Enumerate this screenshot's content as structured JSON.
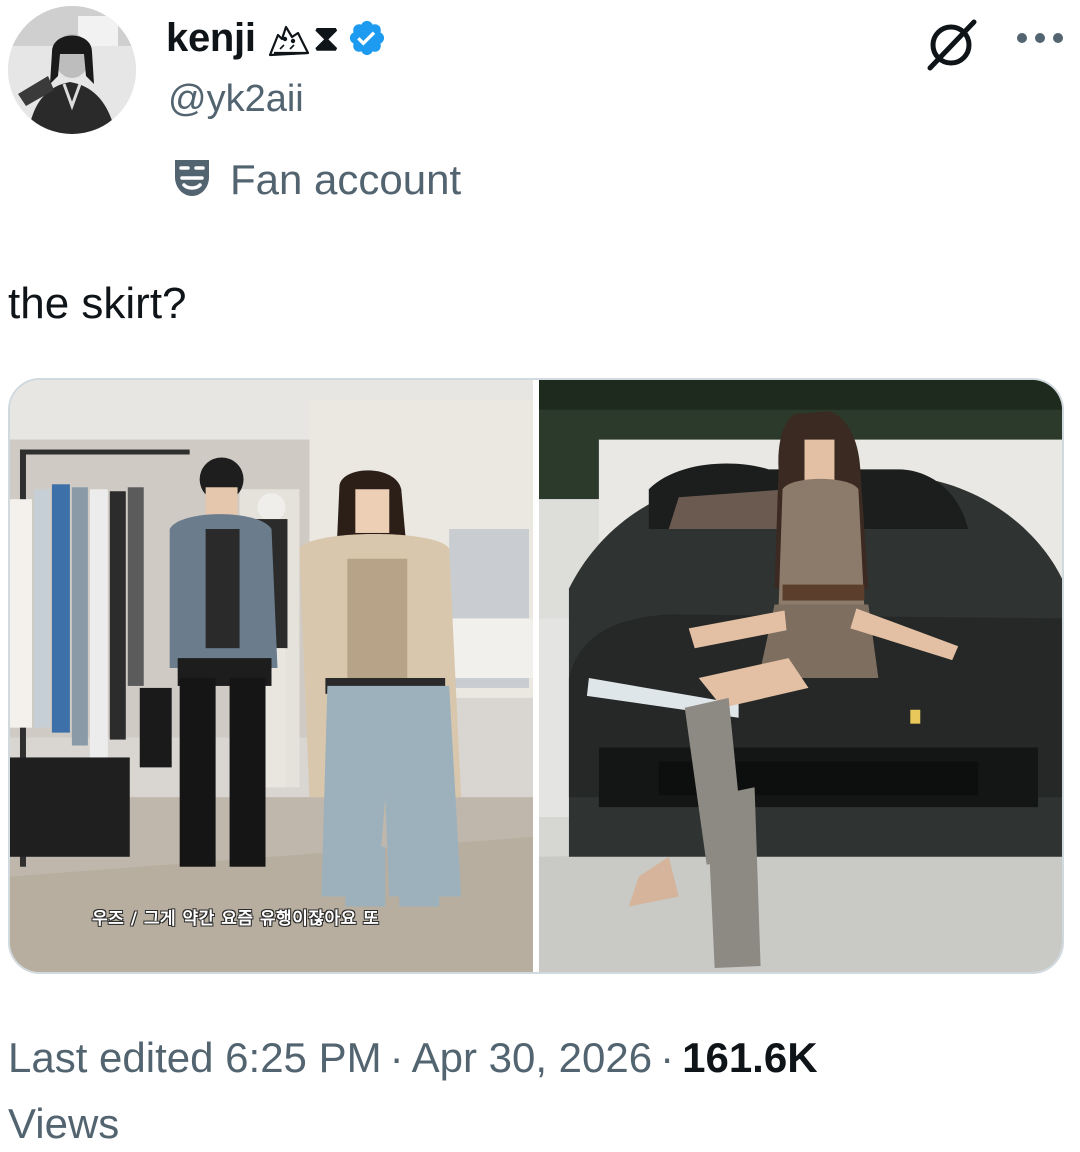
{
  "author": {
    "display_name": "kenji",
    "emoji_hourglass": "⧗",
    "handle": "@yk2aii",
    "label": "Fan account"
  },
  "tweet": {
    "text": "the skirt?"
  },
  "media": {
    "left_subtitle": "우즈 / 그게 약간 요즘 유행이잖아요 또"
  },
  "meta": {
    "edited_prefix": "Last edited",
    "time": "6:25 PM",
    "separator": "·",
    "date": "Apr 30, 2026",
    "views_count": "161.6K",
    "views_label": "Views"
  },
  "colors": {
    "text_primary": "#0f1419",
    "text_secondary": "#536471",
    "verified_blue": "#1d9bf0",
    "border": "#cfd9de"
  },
  "icons": {
    "owl": "owl-icon",
    "verified": "verified-badge-icon",
    "mask": "theater-mask-icon",
    "grok": "grok-icon",
    "more": "more-dots-icon"
  }
}
